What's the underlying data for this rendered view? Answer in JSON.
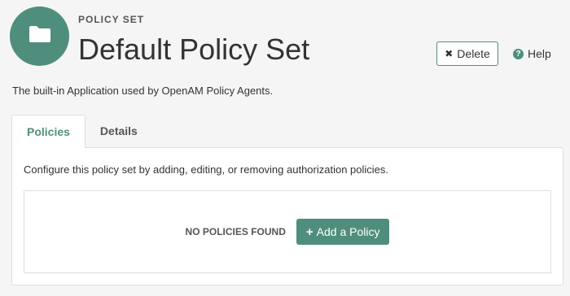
{
  "header": {
    "eyebrow": "POLICY SET",
    "title": "Default Policy Set",
    "avatar_icon": "folder-icon",
    "delete_label": "Delete",
    "help_label": "Help"
  },
  "description": "The built-in Application used by OpenAM Policy Agents.",
  "tabs": [
    {
      "label": "Policies",
      "active": true
    },
    {
      "label": "Details",
      "active": false
    }
  ],
  "panel": {
    "text": "Configure this policy set by adding, editing, or removing authorization policies.",
    "empty_label": "NO POLICIES FOUND",
    "add_label": "Add a Policy"
  },
  "colors": {
    "accent": "#4f8e7d",
    "background": "#f5f5f5"
  }
}
